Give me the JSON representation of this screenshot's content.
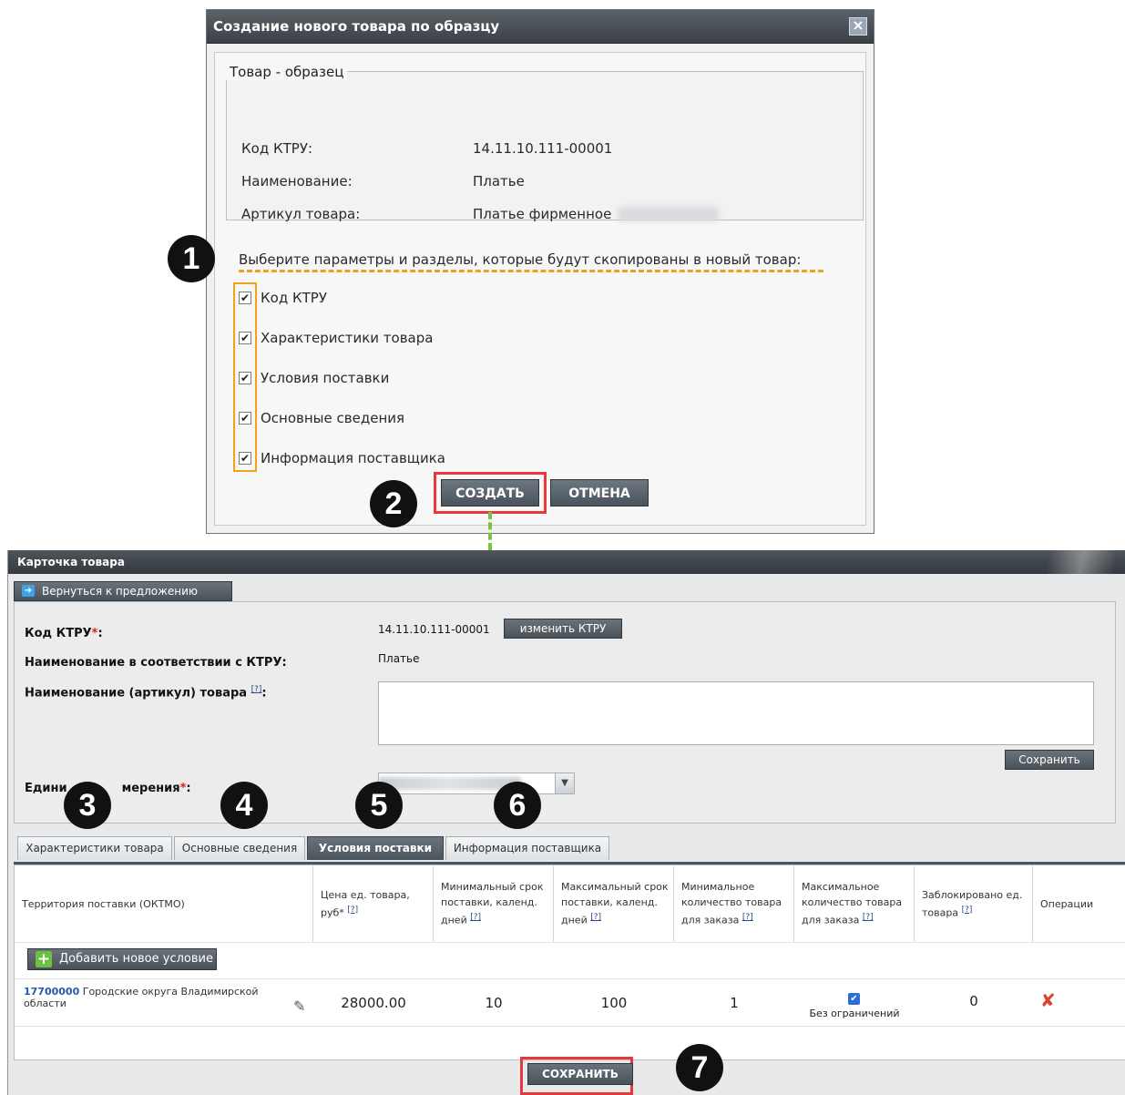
{
  "dialog": {
    "title": "Создание нового товара по образцу",
    "close_icon": "close-icon",
    "sample_section": {
      "legend": "Товар - образец",
      "rows": [
        {
          "label": "Код КТРУ:",
          "value": "14.11.10.111-00001"
        },
        {
          "label": "Наименование:",
          "value": "Платье"
        },
        {
          "label": "Артикул товара:",
          "value": "Платье фирменное"
        }
      ]
    },
    "select_hint": "Выберите параметры и разделы, которые будут скопированы в новый товар:",
    "options": [
      {
        "label": "Код КТРУ",
        "checked": true
      },
      {
        "label": "Характеристики товара",
        "checked": true
      },
      {
        "label": "Условия поставки",
        "checked": true
      },
      {
        "label": "Основные сведения",
        "checked": true
      },
      {
        "label": "Информация поставщика",
        "checked": true
      }
    ],
    "create_button": "СОЗДАТЬ",
    "cancel_button": "ОТМЕНА"
  },
  "callouts": [
    "1",
    "2",
    "3",
    "4",
    "5",
    "6",
    "7"
  ],
  "card": {
    "title": "Карточка товара",
    "back_button": "Вернуться к предложению",
    "fields": {
      "ktru_label": "Код КТРУ",
      "ktru_value": "14.11.10.111-00001",
      "change_ktru_button": "изменить КТРУ",
      "name_label": "Наименование в соответствии с КТРУ:",
      "name_value": "Платье",
      "article_label": "Наименование (артикул) товара",
      "help_mark": "[?]",
      "article_value": "",
      "save_button": "Сохранить",
      "unit_label": "Единица измерения",
      "unit_label_visible": "Едини",
      "unit_label_visible2": "мерения"
    },
    "tabs": [
      {
        "label": "Характеристики товара",
        "active": false
      },
      {
        "label": "Основные сведения",
        "active": false
      },
      {
        "label": "Условия поставки",
        "active": true
      },
      {
        "label": "Информация поставщика",
        "active": false
      }
    ],
    "table": {
      "headers": [
        "Территория поставки (ОКТМО)",
        "Цена ед. товара, руб*",
        "Минимальный срок поставки, календ. дней",
        "Максимальный срок поставки, календ. дней",
        "Минимальное количество товара для заказа",
        "Максимальное количество товара для заказа",
        "Заблокировано ед. товара",
        "Операции"
      ],
      "add_button": "Добавить новое условие",
      "rows": [
        {
          "territory_code": "17700000",
          "territory_name": "Городские округа Владимирской области",
          "price": "28000.00",
          "min_days": "10",
          "max_days": "100",
          "min_qty": "1",
          "max_qty": "Без ограничений",
          "blocked": "0"
        }
      ]
    },
    "save_bottom": "СОХРАНИТЬ"
  },
  "colors": {
    "highlight_orange": "#f0a21a",
    "highlight_red": "#e8383d",
    "arrow_green": "#7cc242"
  }
}
